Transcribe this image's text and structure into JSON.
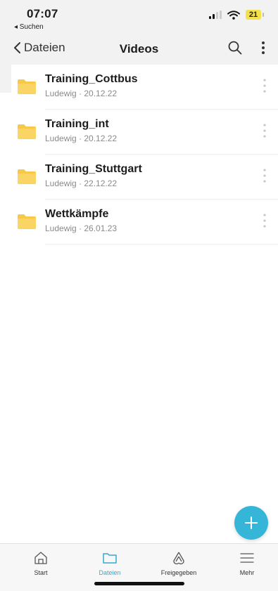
{
  "status_bar": {
    "time": "07:07",
    "back_app": "◂ Suchen",
    "battery": "21"
  },
  "nav": {
    "back_label": "Dateien",
    "title": "Videos"
  },
  "folders": [
    {
      "name": "Training_Cottbus",
      "meta": "Ludewig · 20.12.22"
    },
    {
      "name": "Training_int",
      "meta": "Ludewig · 20.12.22"
    },
    {
      "name": "Training_Stuttgart",
      "meta": "Ludewig · 22.12.22"
    },
    {
      "name": "Wettkämpfe",
      "meta": "Ludewig · 26.01.23"
    }
  ],
  "tabs": [
    {
      "label": "Start",
      "icon": "home-icon"
    },
    {
      "label": "Dateien",
      "icon": "folder-icon",
      "active": true
    },
    {
      "label": "Freigegeben",
      "icon": "shared-icon"
    },
    {
      "label": "Mehr",
      "icon": "menu-icon"
    }
  ],
  "colors": {
    "accent": "#35b6d9",
    "folder": "#f7c948",
    "battery": "#f3e04a"
  }
}
